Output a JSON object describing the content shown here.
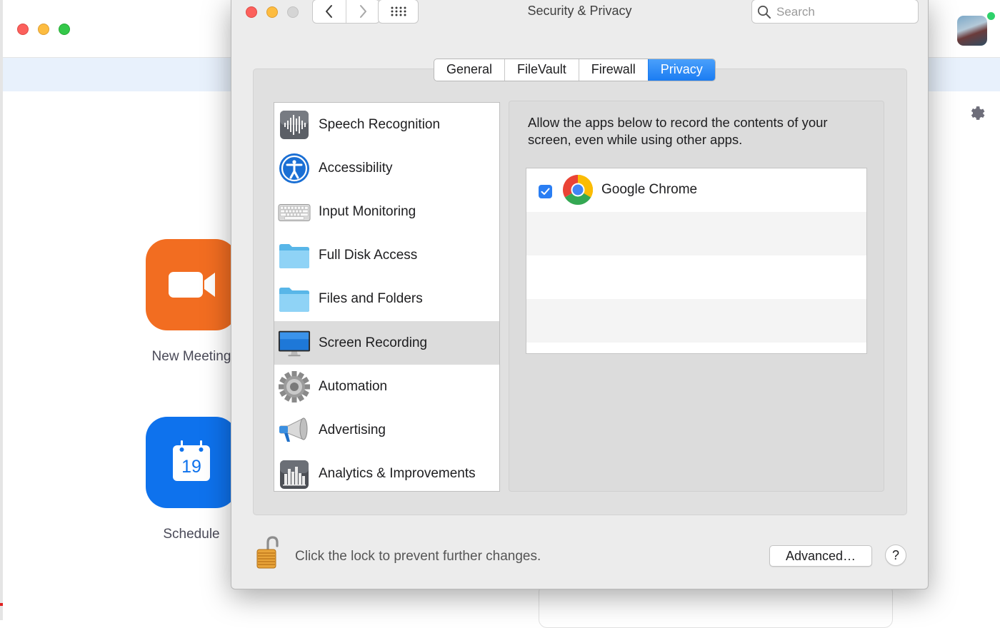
{
  "zoom": {
    "new_meeting_label": "New Meeting",
    "schedule_label": "Schedule",
    "calendar_day": "19",
    "colors": {
      "orange": "#f26d21",
      "blue": "#0e72ed",
      "banner": "#e8f1fc"
    }
  },
  "prefs": {
    "title": "Security & Privacy",
    "search_placeholder": "Search",
    "tabs": [
      {
        "label": "General",
        "active": false
      },
      {
        "label": "FileVault",
        "active": false
      },
      {
        "label": "Firewall",
        "active": false
      },
      {
        "label": "Privacy",
        "active": true
      }
    ],
    "categories": [
      {
        "label": "Speech Recognition",
        "icon": "waveform-icon",
        "selected": false
      },
      {
        "label": "Accessibility",
        "icon": "accessibility-icon",
        "selected": false
      },
      {
        "label": "Input Monitoring",
        "icon": "keyboard-icon",
        "selected": false
      },
      {
        "label": "Full Disk Access",
        "icon": "folder-icon",
        "selected": false
      },
      {
        "label": "Files and Folders",
        "icon": "folder-icon",
        "selected": false
      },
      {
        "label": "Screen Recording",
        "icon": "display-icon",
        "selected": true
      },
      {
        "label": "Automation",
        "icon": "gear-icon",
        "selected": false
      },
      {
        "label": "Advertising",
        "icon": "megaphone-icon",
        "selected": false
      },
      {
        "label": "Analytics & Improvements",
        "icon": "bar-chart-icon",
        "selected": false
      }
    ],
    "description": "Allow the apps below to record the contents of your screen, even while using other apps.",
    "apps": [
      {
        "name": "Google Chrome",
        "checked": true,
        "icon": "chrome-icon"
      }
    ],
    "lock_text": "Click the lock to prevent further changes.",
    "advanced_label": "Advanced…",
    "help_label": "?",
    "accent_color": "#1b7cf2"
  }
}
